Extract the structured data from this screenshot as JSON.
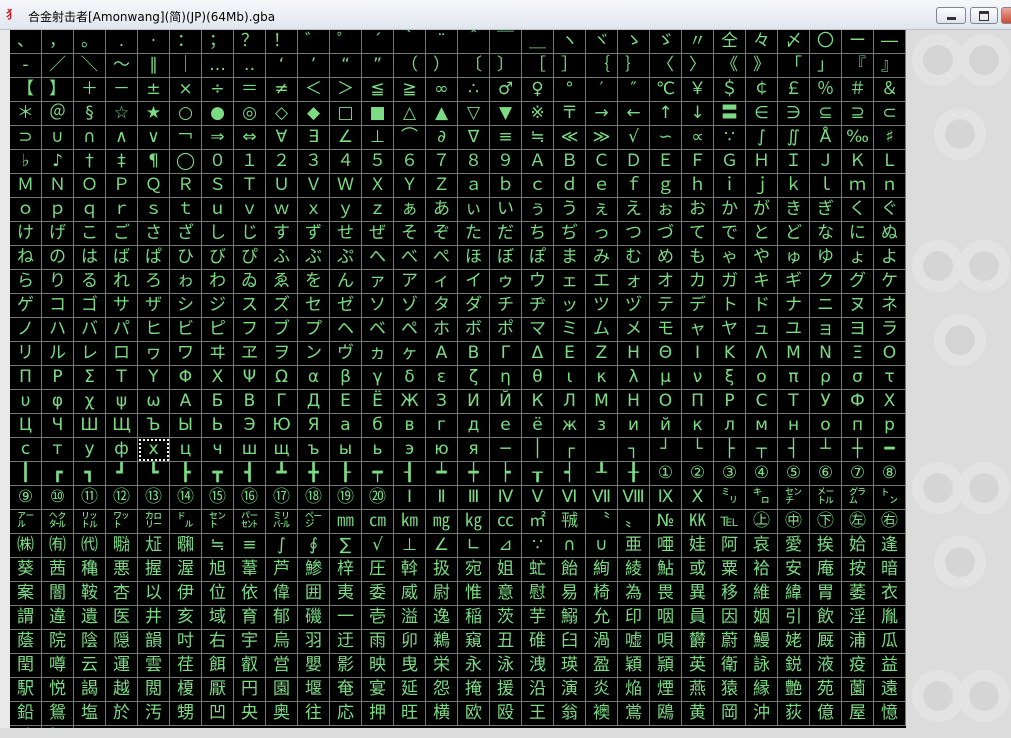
{
  "window": {
    "title": "合金射击者[Amonwang](简)(JP)(64Mb).gba",
    "icon": "gba-app-icon",
    "buttons": {
      "minimize": "minimize-icon",
      "maximize": "maximize-icon",
      "close": "close-icon"
    }
  },
  "colors": {
    "glyph": "#7cdc84",
    "background": "#000000",
    "gridline": "#6f7a6f",
    "panel": "#dcdcdc"
  },
  "tiles": [
    "、",
    "，",
    "。",
    ".",
    "·",
    "：",
    "；",
    "？",
    "！",
    "゛",
    "゜",
    "´",
    "｀",
    "¨",
    "＾",
    "￣",
    "＿",
    "ヽ",
    "ヾ",
    "ゝ",
    "ゞ",
    "〃",
    "仝",
    "々",
    "〆",
    "〇",
    "ー",
    "―",
    "‐",
    "／",
    "＼",
    "～",
    "∥",
    "｜",
    "…",
    "‥",
    "‘",
    "’",
    "“",
    "”",
    "（",
    "）",
    "〔",
    "〕",
    "［",
    "］",
    "｛",
    "｝",
    "〈",
    "〉",
    "《",
    "》",
    "「",
    "」",
    "『",
    "』",
    "【",
    "】",
    "＋",
    "－",
    "±",
    "×",
    "÷",
    "＝",
    "≠",
    "＜",
    "＞",
    "≦",
    "≧",
    "∞",
    "∴",
    "♂",
    "♀",
    "°",
    "′",
    "″",
    "℃",
    "￥",
    "＄",
    "￠",
    "￡",
    "％",
    "＃",
    "＆",
    "＊",
    "＠",
    "§",
    "☆",
    "★",
    "○",
    "●",
    "◎",
    "◇",
    "◆",
    "□",
    "■",
    "△",
    "▲",
    "▽",
    "▼",
    "※",
    "〒",
    "→",
    "←",
    "↑",
    "↓",
    "〓",
    "∈",
    "∋",
    "⊆",
    "⊇",
    "⊂",
    "⊃",
    "∪",
    "∩",
    "∧",
    "∨",
    "￢",
    "⇒",
    "⇔",
    "∀",
    "∃",
    "∠",
    "⊥",
    "⌒",
    "∂",
    "∇",
    "≡",
    "≒",
    "≪",
    "≫",
    "√",
    "∽",
    "∝",
    "∵",
    "∫",
    "∬",
    "Å",
    "‰",
    "♯",
    "♭",
    "♪",
    "†",
    "‡",
    "¶",
    "◯",
    "０",
    "１",
    "２",
    "３",
    "４",
    "５",
    "６",
    "７",
    "８",
    "９",
    "Ａ",
    "Ｂ",
    "Ｃ",
    "Ｄ",
    "Ｅ",
    "Ｆ",
    "Ｇ",
    "Ｈ",
    "Ｉ",
    "Ｊ",
    "Ｋ",
    "Ｌ",
    "Ｍ",
    "Ｎ",
    "Ｏ",
    "Ｐ",
    "Ｑ",
    "Ｒ",
    "Ｓ",
    "Ｔ",
    "Ｕ",
    "Ｖ",
    "Ｗ",
    "Ｘ",
    "Ｙ",
    "Ｚ",
    "ａ",
    "ｂ",
    "ｃ",
    "ｄ",
    "ｅ",
    "ｆ",
    "ｇ",
    "ｈ",
    "ｉ",
    "ｊ",
    "ｋ",
    "ｌ",
    "ｍ",
    "ｎ",
    "ｏ",
    "ｐ",
    "ｑ",
    "ｒ",
    "ｓ",
    "ｔ",
    "ｕ",
    "ｖ",
    "ｗ",
    "ｘ",
    "ｙ",
    "ｚ",
    "ぁ",
    "あ",
    "ぃ",
    "い",
    "ぅ",
    "う",
    "ぇ",
    "え",
    "ぉ",
    "お",
    "か",
    "が",
    "き",
    "ぎ",
    "く",
    "ぐ",
    "け",
    "げ",
    "こ",
    "ご",
    "さ",
    "ざ",
    "し",
    "じ",
    "す",
    "ず",
    "せ",
    "ぜ",
    "そ",
    "ぞ",
    "た",
    "だ",
    "ち",
    "ぢ",
    "っ",
    "つ",
    "づ",
    "て",
    "で",
    "と",
    "ど",
    "な",
    "に",
    "ぬ",
    "ね",
    "の",
    "は",
    "ば",
    "ぱ",
    "ひ",
    "び",
    "ぴ",
    "ふ",
    "ぶ",
    "ぷ",
    "へ",
    "べ",
    "ぺ",
    "ほ",
    "ぼ",
    "ぽ",
    "ま",
    "み",
    "む",
    "め",
    "も",
    "ゃ",
    "や",
    "ゅ",
    "ゆ",
    "ょ",
    "よ",
    "ら",
    "り",
    "る",
    "れ",
    "ろ",
    "ゎ",
    "わ",
    "ゐ",
    "ゑ",
    "を",
    "ん",
    "ァ",
    "ア",
    "ィ",
    "イ",
    "ゥ",
    "ウ",
    "ェ",
    "エ",
    "ォ",
    "オ",
    "カ",
    "ガ",
    "キ",
    "ギ",
    "ク",
    "グ",
    "ケ",
    "ゲ",
    "コ",
    "ゴ",
    "サ",
    "ザ",
    "シ",
    "ジ",
    "ス",
    "ズ",
    "セ",
    "ゼ",
    "ソ",
    "ゾ",
    "タ",
    "ダ",
    "チ",
    "ヂ",
    "ッ",
    "ツ",
    "ヅ",
    "テ",
    "デ",
    "ト",
    "ド",
    "ナ",
    "ニ",
    "ヌ",
    "ネ",
    "ノ",
    "ハ",
    "バ",
    "パ",
    "ヒ",
    "ビ",
    "ピ",
    "フ",
    "ブ",
    "プ",
    "ヘ",
    "ベ",
    "ペ",
    "ホ",
    "ボ",
    "ポ",
    "マ",
    "ミ",
    "ム",
    "メ",
    "モ",
    "ャ",
    "ヤ",
    "ュ",
    "ユ",
    "ョ",
    "ヨ",
    "ラ",
    "リ",
    "ル",
    "レ",
    "ロ",
    "ヮ",
    "ワ",
    "ヰ",
    "ヱ",
    "ヲ",
    "ン",
    "ヴ",
    "ヵ",
    "ヶ",
    "Α",
    "Β",
    "Γ",
    "Δ",
    "Ε",
    "Ζ",
    "Η",
    "Θ",
    "Ι",
    "Κ",
    "Λ",
    "Μ",
    "Ν",
    "Ξ",
    "Ο",
    "Π",
    "Ρ",
    "Σ",
    "Τ",
    "Υ",
    "Φ",
    "Χ",
    "Ψ",
    "Ω",
    "α",
    "β",
    "γ",
    "δ",
    "ε",
    "ζ",
    "η",
    "θ",
    "ι",
    "κ",
    "λ",
    "μ",
    "ν",
    "ξ",
    "ο",
    "π",
    "ρ",
    "σ",
    "τ",
    "υ",
    "φ",
    "χ",
    "ψ",
    "ω",
    "А",
    "Б",
    "В",
    "Г",
    "Д",
    "Е",
    "Ё",
    "Ж",
    "З",
    "И",
    "Й",
    "К",
    "Л",
    "М",
    "Н",
    "О",
    "П",
    "Р",
    "С",
    "Т",
    "У",
    "Ф",
    "Х",
    "Ц",
    "Ч",
    "Ш",
    "Щ",
    "Ъ",
    "Ы",
    "Ь",
    "Э",
    "Ю",
    "Я",
    "а",
    "б",
    "в",
    "г",
    "д",
    "е",
    "ё",
    "ж",
    "з",
    "и",
    "й",
    "к",
    "л",
    "м",
    "н",
    "о",
    "п",
    "р",
    "с",
    "т",
    "у",
    "ф",
    "х",
    "ц",
    "ч",
    "ш",
    "щ",
    "ъ",
    "ы",
    "ь",
    "э",
    "ю",
    "я",
    "─",
    "│",
    "┌",
    "",
    "┐",
    "┘",
    "└",
    "├",
    "┬",
    "┤",
    "┴",
    "┼",
    "━",
    "┃",
    "┏",
    "┓",
    "┛",
    "┗",
    "┣",
    "┳",
    "┫",
    "┻",
    "╋",
    "┠",
    "┯",
    "┨",
    "┷",
    "┿",
    "┝",
    "┰",
    "┥",
    "┸",
    "╂",
    "①",
    "②",
    "③",
    "④",
    "⑤",
    "⑥",
    "⑦",
    "⑧",
    "⑨",
    "⑩",
    "⑪",
    "⑫",
    "⑬",
    "⑭",
    "⑮",
    "⑯",
    "⑰",
    "⑱",
    "⑲",
    "⑳",
    "Ⅰ",
    "Ⅱ",
    "Ⅲ",
    "Ⅳ",
    "Ⅴ",
    "Ⅵ",
    "Ⅶ",
    "Ⅷ",
    "Ⅸ",
    "Ⅹ",
    "㍉",
    "㌔",
    "㌢",
    "㍍",
    "㌘",
    "㌧",
    "㌃",
    "㌶",
    "㍑",
    "㍗",
    "㌍",
    "㌦",
    "㌣",
    "㌫",
    "㍊",
    "㌻",
    "㎜",
    "㎝",
    "㎞",
    "㎎",
    "㎏",
    "㏄",
    "㎡",
    "㍻",
    "〝",
    "〟",
    "№",
    "㏍",
    "℡",
    "㊤",
    "㊥",
    "㊦",
    "㊧",
    "㊨",
    "㈱",
    "㈲",
    "㈹",
    "㍾",
    "㍽",
    "㍼",
    "≒",
    "≡",
    "∫",
    "∮",
    "∑",
    "√",
    "⊥",
    "∠",
    "∟",
    "⊿",
    "∵",
    "∩",
    "∪",
    "亜",
    "唖",
    "娃",
    "阿",
    "哀",
    "愛",
    "挨",
    "姶",
    "逢",
    "葵",
    "茜",
    "穐",
    "悪",
    "握",
    "渥",
    "旭",
    "葦",
    "芦",
    "鯵",
    "梓",
    "圧",
    "斡",
    "扱",
    "宛",
    "姐",
    "虻",
    "飴",
    "絢",
    "綾",
    "鮎",
    "或",
    "粟",
    "袷",
    "安",
    "庵",
    "按",
    "暗",
    "案",
    "闇",
    "鞍",
    "杏",
    "以",
    "伊",
    "位",
    "依",
    "偉",
    "囲",
    "夷",
    "委",
    "威",
    "尉",
    "惟",
    "意",
    "慰",
    "易",
    "椅",
    "為",
    "畏",
    "異",
    "移",
    "維",
    "緯",
    "胃",
    "萎",
    "衣",
    "謂",
    "違",
    "遺",
    "医",
    "井",
    "亥",
    "域",
    "育",
    "郁",
    "磯",
    "一",
    "壱",
    "溢",
    "逸",
    "稲",
    "茨",
    "芋",
    "鰯",
    "允",
    "印",
    "咽",
    "員",
    "因",
    "姻",
    "引",
    "飲",
    "淫",
    "胤",
    "蔭",
    "院",
    "陰",
    "隠",
    "韻",
    "吋",
    "右",
    "宇",
    "烏",
    "羽",
    "迂",
    "雨",
    "卯",
    "鵜",
    "窺",
    "丑",
    "碓",
    "臼",
    "渦",
    "嘘",
    "唄",
    "欝",
    "蔚",
    "鰻",
    "姥",
    "厩",
    "浦",
    "瓜",
    "閏",
    "噂",
    "云",
    "運",
    "雲",
    "荏",
    "餌",
    "叡",
    "営",
    "嬰",
    "影",
    "映",
    "曳",
    "栄",
    "永",
    "泳",
    "洩",
    "瑛",
    "盈",
    "穎",
    "頴",
    "英",
    "衛",
    "詠",
    "鋭",
    "液",
    "疫",
    "益",
    "駅",
    "悦",
    "謁",
    "越",
    "閲",
    "榎",
    "厭",
    "円",
    "園",
    "堰",
    "奄",
    "宴",
    "延",
    "怨",
    "掩",
    "援",
    "沿",
    "演",
    "炎",
    "焔",
    "煙",
    "燕",
    "猿",
    "縁",
    "艶",
    "苑",
    "薗",
    "遠",
    "鉛",
    "鴛",
    "塩",
    "於",
    "汚",
    "甥",
    "凹",
    "央",
    "奥",
    "往",
    "応",
    "押",
    "旺",
    "横",
    "欧",
    "殴",
    "王",
    "翁",
    "襖",
    "鴬",
    "鴎",
    "黄",
    "岡",
    "沖",
    "荻",
    "億",
    "屋",
    "憶",
    "臆",
    "桶"
  ]
}
